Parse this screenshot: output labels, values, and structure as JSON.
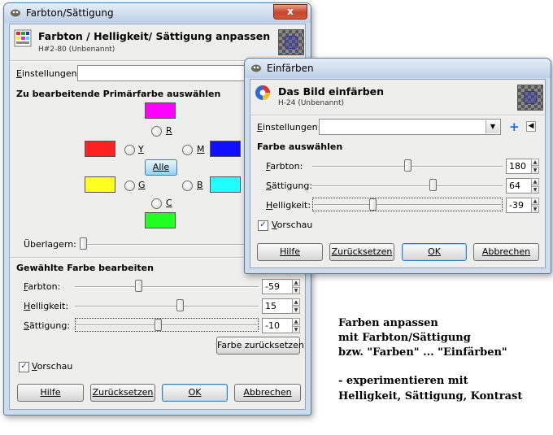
{
  "colors": {
    "magenta": "#ff00ff",
    "red": "#ff2020",
    "blue": "#1010ff",
    "yellow": "#ffff20",
    "cyan": "#20ffff",
    "green": "#20ff20",
    "caption": "#000000"
  },
  "win1": {
    "title": "Farbton/Sättigung",
    "close_label": "x",
    "header_title": "Farbton / Helligkeit/ Sättigung anpassen",
    "header_sub": "H#2-80 (Unbenannt)",
    "einstellungen_label": "Einstellungen:",
    "section_primary": "Zu bearbeitende Primärfarbe auswählen",
    "radio_r": "R",
    "radio_y": "Y",
    "radio_m": "M",
    "radio_g": "G",
    "radio_b": "B",
    "radio_c": "C",
    "alle_button": "Alle",
    "ueberlagern_label": "Überlagern:",
    "section_edit": "Gewählte Farbe bearbeiten",
    "farbton_label": "Farbton:",
    "farbton_value": "-59",
    "farbton_fraction": 0.34,
    "helligkeit_label": "Helligkeit:",
    "helligkeit_value": "15",
    "helligkeit_fraction": 0.575,
    "saettigung_label": "Sättigung:",
    "saettigung_value": "-10",
    "saettigung_fraction": 0.45,
    "reset_color_button": "Farbe zurücksetzen",
    "vorschau_label": "Vorschau",
    "hilfe_button": "Hilfe",
    "zuruecksetzen_button": "Zurücksetzen",
    "ok_button": "OK",
    "abbrechen_button": "Abbrechen"
  },
  "win2": {
    "title": "Einfärben",
    "close_label": "x",
    "header_title": "Das Bild einfärben",
    "header_sub": "H-24 (Unbenannt)",
    "einstellungen_label": "Einstellungen:",
    "section_color": "Farbe auswählen",
    "farbton_label": "Farbton:",
    "farbton_value": "180",
    "farbton_fraction": 0.5,
    "saettigung_label": "Sättigung:",
    "saettigung_value": "64",
    "saettigung_fraction": 0.64,
    "helligkeit_label": "Helligkeit:",
    "helligkeit_value": "-39",
    "helligkeit_fraction": 0.31,
    "vorschau_label": "Vorschau",
    "hilfe_button": "Hilfe",
    "zuruecksetzen_button": "Zurücksetzen",
    "ok_button": "OK",
    "abbrechen_button": "Abbrechen"
  },
  "caption": {
    "line1": "Farben anpassen",
    "line2": "mit Farbton/Sättigung",
    "line3": "bzw. \"Farben\" ... \"Einfärben\"",
    "line4": "- experimentieren mit",
    "line5": "Helligkeit, Sättigung, Kontrast"
  }
}
